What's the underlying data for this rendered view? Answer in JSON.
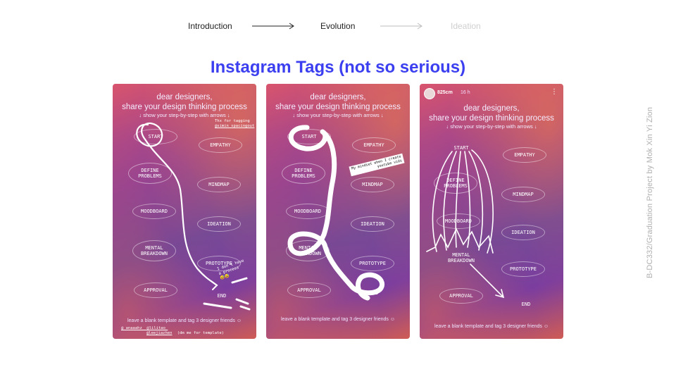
{
  "nav": {
    "items": [
      {
        "label": "Introduction",
        "state": "visited"
      },
      {
        "label": "Evolution",
        "state": "current"
      },
      {
        "label": "Ideation",
        "state": "upcoming"
      }
    ]
  },
  "title": "Instagram Tags (not so serious)",
  "side_caption": "B-DC332/Graduation Project by Mok Xin Yi Zion",
  "template": {
    "heading_line1": "dear designers,",
    "heading_line2": "share your design thinking process",
    "subheading": "↓ show your step-by-step with arrows ↓",
    "steps": {
      "start": "START",
      "empathy": "EMPATHY",
      "define": "DEFINE PROBLEMS",
      "mindmap": "MINDMAP",
      "moodboard": "MOODBOARD",
      "ideation": "IDEATION",
      "mental": "MENTAL BREAKDOWN",
      "prototype": "PROTOTYPE",
      "approval": "APPROVAL",
      "end": "END"
    },
    "footer": "leave a blank template and tag 3 designer friends ☺"
  },
  "card1": {
    "tag_thanks_1": "Thx for tagging",
    "tag_thanks_2": "@simin_spacingout",
    "process_note_1": "I don't have",
    "process_note_2": "a process",
    "process_emoji": "😅😅",
    "mentions_1": "@_anaaahz_  @lilitao_",
    "mentions_2": "@leejiazhen",
    "mentions_note": "(dm me for template)"
  },
  "card2": {
    "sticker_1": "My mindset when I create",
    "sticker_2": "youtube vids"
  },
  "card3": {
    "username": "825cm",
    "time": "16 h",
    "more_icon": "⋮"
  },
  "colors": {
    "accent": "#3b3ff0",
    "nav_inactive": "#cfcfcf"
  }
}
